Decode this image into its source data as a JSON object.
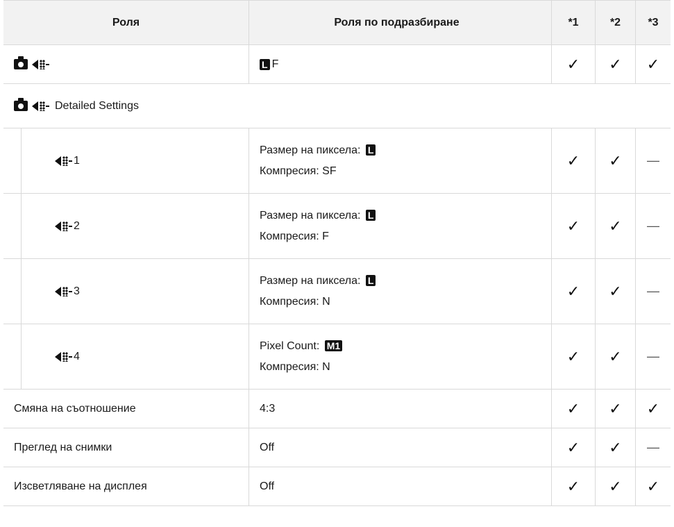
{
  "header": {
    "col1": "Роля",
    "col2": "Роля по подразбиране",
    "col3": "*1",
    "col4": "*2",
    "col5": "*3"
  },
  "rows": {
    "quality": {
      "value_box": "L",
      "value_suffix": "F",
      "c1": "✓",
      "c2": "✓",
      "c3": "✓"
    },
    "detailed": {
      "label": "Detailed Settings"
    },
    "sub1": {
      "suffix": "1",
      "line1": "Размер на пиксела: ",
      "box": "L",
      "line2": "Компресия: SF",
      "c1": "✓",
      "c2": "✓",
      "c3": "—"
    },
    "sub2": {
      "suffix": "2",
      "line1": "Размер на пиксела: ",
      "box": "L",
      "line2": "Компресия: F",
      "c1": "✓",
      "c2": "✓",
      "c3": "—"
    },
    "sub3": {
      "suffix": "3",
      "line1": "Размер на пиксела: ",
      "box": "L",
      "line2": "Компресия: N",
      "c1": "✓",
      "c2": "✓",
      "c3": "—"
    },
    "sub4": {
      "suffix": "4",
      "line1": "Pixel Count: ",
      "box": "M1",
      "line2": "Компресия: N",
      "c1": "✓",
      "c2": "✓",
      "c3": "—"
    },
    "aspect": {
      "label": "Смяна на съотношение",
      "value": "4:3",
      "c1": "✓",
      "c2": "✓",
      "c3": "✓"
    },
    "review": {
      "label": "Преглед на снимки",
      "value": "Off",
      "c1": "✓",
      "c2": "✓",
      "c3": "—"
    },
    "backlight": {
      "label": "Изсветляване на дисплея",
      "value": "Off",
      "c1": "✓",
      "c2": "✓",
      "c3": "✓"
    }
  },
  "icons": {
    "camera": "camera-icon",
    "quality": "image-quality-icon"
  }
}
